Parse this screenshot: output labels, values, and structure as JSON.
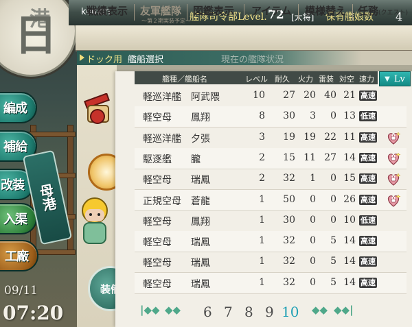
{
  "header": {
    "username": "koukin",
    "hq_label": "艦隊司令部Level.",
    "hq_level": "72",
    "rank": "[大将]",
    "ship_count_label": "保有艦娘数",
    "ship_count": "4"
  },
  "menu": {
    "items": [
      {
        "label": "戦績表示"
      },
      {
        "label": "友軍艦隊",
        "disabled": true
      },
      {
        "label": "図鑑表示"
      },
      {
        "label": "アイテム"
      },
      {
        "label": "模様替え"
      },
      {
        "label": "任務",
        "sub": "(クエスト)"
      }
    ],
    "friend_sub": "～第２期実装予定～"
  },
  "breadcrumb": {
    "section": "ドック用",
    "current": "艦船選択",
    "faded": "現在の艦隊状況"
  },
  "side_menu": {
    "hensei": "編成",
    "hokyu": "補給",
    "kaiso": "改装",
    "nyukyo": "入渠",
    "kosho": "工廠",
    "modoru": "母港"
  },
  "clock": {
    "date": "09/11",
    "time": "07:20"
  },
  "supply_btn": "装備",
  "table": {
    "headers": {
      "name": "艦種／艦船名",
      "level": "レベル",
      "hp": "耐久",
      "firepower": "火力",
      "torpedo": "雷装",
      "aa": "対空",
      "speed": "速力"
    },
    "sort_label": "Lv",
    "rows": [
      {
        "type": "軽巡洋艦",
        "name": "阿武隈",
        "level": "10",
        "hp": "27",
        "fp": "20",
        "tp": "40",
        "aa": "21",
        "speed": "高速",
        "locked": false
      },
      {
        "type": "軽空母",
        "name": "鳳翔",
        "level": "8",
        "hp": "30",
        "fp": "3",
        "tp": "0",
        "aa": "13",
        "speed": "低速",
        "locked": false
      },
      {
        "type": "軽巡洋艦",
        "name": "夕張",
        "level": "3",
        "hp": "19",
        "fp": "19",
        "tp": "22",
        "aa": "11",
        "speed": "高速",
        "locked": true
      },
      {
        "type": "駆逐艦",
        "name": "朧",
        "level": "2",
        "hp": "15",
        "fp": "11",
        "tp": "27",
        "aa": "14",
        "speed": "高速",
        "locked": true
      },
      {
        "type": "軽空母",
        "name": "瑞鳳",
        "level": "2",
        "hp": "32",
        "fp": "1",
        "tp": "0",
        "aa": "15",
        "speed": "高速",
        "locked": true
      },
      {
        "type": "正規空母",
        "name": "蒼龍",
        "level": "1",
        "hp": "50",
        "fp": "0",
        "tp": "0",
        "aa": "26",
        "speed": "高速",
        "locked": true
      },
      {
        "type": "軽空母",
        "name": "鳳翔",
        "level": "1",
        "hp": "30",
        "fp": "0",
        "tp": "0",
        "aa": "10",
        "speed": "低速",
        "locked": false
      },
      {
        "type": "軽空母",
        "name": "瑞鳳",
        "level": "1",
        "hp": "32",
        "fp": "0",
        "tp": "5",
        "aa": "14",
        "speed": "高速",
        "locked": false
      },
      {
        "type": "軽空母",
        "name": "瑞鳳",
        "level": "1",
        "hp": "32",
        "fp": "0",
        "tp": "5",
        "aa": "14",
        "speed": "高速",
        "locked": false
      },
      {
        "type": "軽空母",
        "name": "瑞鳳",
        "level": "1",
        "hp": "32",
        "fp": "0",
        "tp": "5",
        "aa": "14",
        "speed": "高速",
        "locked": false
      }
    ]
  },
  "pagination": {
    "first": "|◆◆",
    "prev": "◆◆",
    "pages": [
      "6",
      "7",
      "8",
      "9",
      "10"
    ],
    "current": "10",
    "next": "◆◆",
    "last": "◆◆|"
  },
  "icons": {
    "lock": "heart-lock-icon"
  },
  "colors": {
    "accent_teal": "#2fb6b0",
    "header_gold": "#f0e18a",
    "lock_pink": "#e79aa6"
  }
}
